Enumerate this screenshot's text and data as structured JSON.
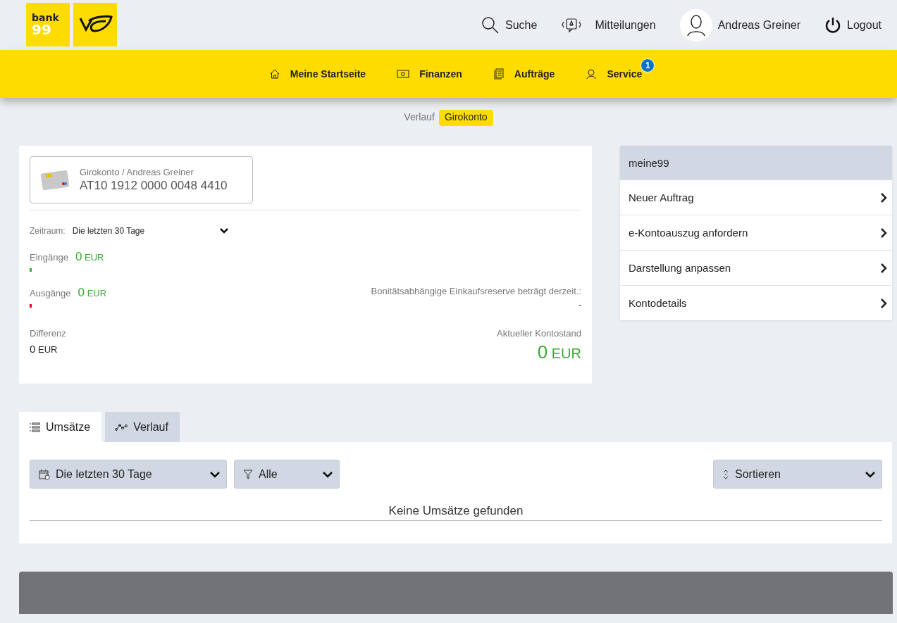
{
  "logo": {
    "text": "bank",
    "number": "99"
  },
  "header_links": [
    {
      "kind": "search",
      "label": "Suche"
    },
    {
      "kind": "messages",
      "label": "Mitteilungen"
    },
    {
      "kind": "user",
      "label": "Andreas Greiner"
    },
    {
      "kind": "logout",
      "label": "Logout"
    }
  ],
  "nav": [
    {
      "kind": "home",
      "label": "Meine Startseite"
    },
    {
      "kind": "money",
      "label": "Finanzen"
    },
    {
      "kind": "orders",
      "label": "Aufträge"
    },
    {
      "kind": "service",
      "label": "Service",
      "badge": "1"
    }
  ],
  "breadcrumb": [
    {
      "label": "Verlauf",
      "selected": false
    },
    {
      "label": "Girokonto",
      "selected": true
    }
  ],
  "account": {
    "owner": "Girokonto / Andreas Greiner",
    "iban": "AT10 1912 0000 0048 4410"
  },
  "period": {
    "label": "Zeitraum:",
    "value": "Die letzten 30 Tage"
  },
  "flows": [
    {
      "label": "Eingänge",
      "amount": "0",
      "currency": "EUR",
      "color": "#3aaa35"
    },
    {
      "label": "Ausgänge",
      "amount": "0",
      "currency": "EUR",
      "color": "#e2001a"
    }
  ],
  "reserve": {
    "label": "Bonitätsabhängige Einkaufsreserve beträgt derzeit.:",
    "value": "-"
  },
  "difference": {
    "label": "Differenz",
    "amount": "0",
    "currency": "EUR"
  },
  "balance": {
    "label": "Aktueller Kontostand",
    "amount": "0",
    "currency": "EUR"
  },
  "side_menu": {
    "title": "meine99",
    "items": [
      "Neuer Auftrag",
      "e-Kontoauszug anfordern",
      "Darstellung anpassen",
      "Kontodetails"
    ]
  },
  "tabs": [
    {
      "kind": "list",
      "label": "Umsätze",
      "selected": true
    },
    {
      "kind": "chart",
      "label": "Verlauf",
      "selected": false
    }
  ],
  "filters": [
    {
      "kind": "calendar",
      "label": "Die letzten 30 Tage"
    },
    {
      "kind": "filter",
      "label": "Alle"
    },
    {
      "kind": "sort",
      "label": "Sortieren"
    }
  ],
  "empty_message": "Keine Umsätze gefunden"
}
